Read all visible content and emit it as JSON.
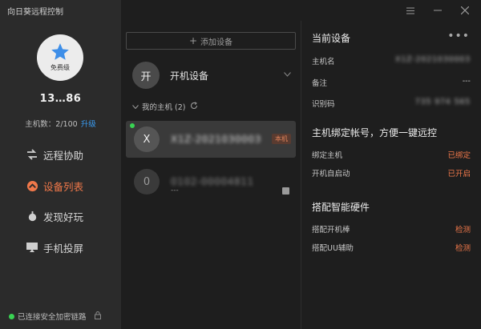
{
  "app": {
    "title": "向日葵远程控制"
  },
  "user": {
    "tier": "免费级",
    "name": "13…86",
    "host_count": "主机数：2/100",
    "upgrade": "升级"
  },
  "nav": [
    {
      "label": "远程协助",
      "icon": "remote-assist-icon"
    },
    {
      "label": "设备列表",
      "icon": "device-list-icon",
      "active": true
    },
    {
      "label": "发现好玩",
      "icon": "discover-icon"
    },
    {
      "label": "手机投屏",
      "icon": "screen-mirror-icon"
    }
  ],
  "footer": {
    "status": "已连接安全加密链路"
  },
  "middle": {
    "add_device": "添加设备",
    "power_device": {
      "badge": "开",
      "label": "开机设备"
    },
    "my_hosts": {
      "label": "我的主机 (2)"
    },
    "devices": [
      {
        "initial": "X",
        "id": "X1Z-2021030003",
        "badge": "本机",
        "online": true
      },
      {
        "initial": "0",
        "id": "0102-00004811",
        "sub": "---",
        "online": false
      }
    ]
  },
  "right": {
    "current_title": "当前设备",
    "hostname_label": "主机名",
    "hostname_value": "X1Z-2021030003",
    "remark_label": "备注",
    "remark_value": "---",
    "code_label": "识别码",
    "code_value": "735 974 565",
    "bind_title": "主机绑定帐号，方便一键远控",
    "bind_host_label": "绑定主机",
    "bind_host_value": "已绑定",
    "autostart_label": "开机自启动",
    "autostart_value": "已开启",
    "hardware_title": "搭配智能硬件",
    "hw1_label": "搭配开机棒",
    "hw1_value": "检测",
    "hw2_label": "搭配UU辅助",
    "hw2_value": "检测"
  },
  "colors": {
    "accent": "#f0784a",
    "link": "#3a9cf2",
    "online": "#39d353",
    "sidebar_bg": "#2b2b2b",
    "main_bg": "#1e1e1e"
  }
}
